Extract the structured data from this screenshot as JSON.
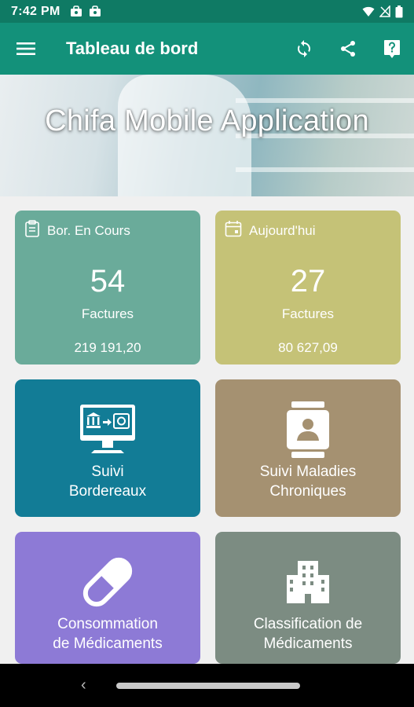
{
  "status_bar": {
    "time": "7:42 PM"
  },
  "app_bar": {
    "title": "Tableau de bord"
  },
  "banner": {
    "headline": "Chifa Mobile Application"
  },
  "stats": [
    {
      "title": "Bor. En Cours",
      "count": "54",
      "unit": "Factures",
      "amount": "219 191,20",
      "color": "#6aab9a"
    },
    {
      "title": "Aujourd'hui",
      "count": "27",
      "unit": "Factures",
      "amount": "80 627,09",
      "color": "#c5c277"
    }
  ],
  "tiles": [
    {
      "line1": "Suivi",
      "line2": "Bordereaux",
      "color": "#127c96",
      "icon": "monitor-bank-transfer-icon"
    },
    {
      "line1": "Suivi Maladies",
      "line2": "Chroniques",
      "color": "#a59171",
      "icon": "medical-record-icon"
    },
    {
      "line1": "Consommation",
      "line2": "de Médicaments",
      "color": "#8d7ad6",
      "icon": "pill-icon"
    },
    {
      "line1": "Classification de",
      "line2": "Médicaments",
      "color": "#7c8c82",
      "icon": "building-icon"
    }
  ]
}
